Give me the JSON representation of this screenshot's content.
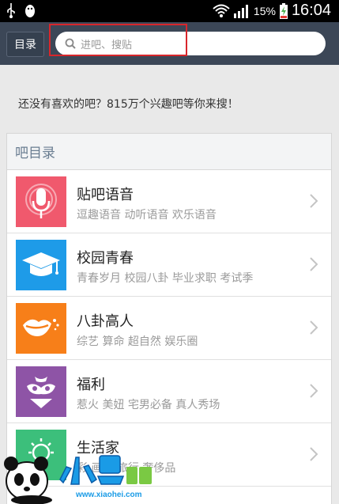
{
  "status_bar": {
    "battery_percent": "15%",
    "time": "16:04",
    "icons": [
      "usb-icon",
      "penguin-icon",
      "wifi-icon",
      "signal-icon",
      "battery-charging-icon"
    ]
  },
  "header": {
    "catalog_label": "目录",
    "search_placeholder": "进吧、搜贴"
  },
  "promo_text": "还没有喜欢的吧？815万个兴趣吧等你来搜！",
  "catalog": {
    "title": "吧目录",
    "items": [
      {
        "title": "贴吧语音",
        "tags": "逗趣语音 动听语音 欢乐语音",
        "icon": "microphone-icon",
        "color": "#f0596d"
      },
      {
        "title": "校园青春",
        "tags": "青春岁月 校园八卦 毕业求职 考试季",
        "icon": "graduation-cap-icon",
        "color": "#1e9be8"
      },
      {
        "title": "八卦高人",
        "tags": "综艺 算命 超自然 娱乐圈",
        "icon": "lips-icon",
        "color": "#f77f19"
      },
      {
        "title": "福利",
        "tags": "惹火 美妞 宅男必备 真人秀场",
        "icon": "bikini-icon",
        "color": "#8e54a6"
      },
      {
        "title": "生活家",
        "tags": "彩 画画 旅行 奢侈品",
        "icon": "bulb-icon",
        "color": "#3cbf7b"
      }
    ]
  },
  "watermark": {
    "brand": "小黑游戏",
    "url": "www.xiaohei.com"
  }
}
